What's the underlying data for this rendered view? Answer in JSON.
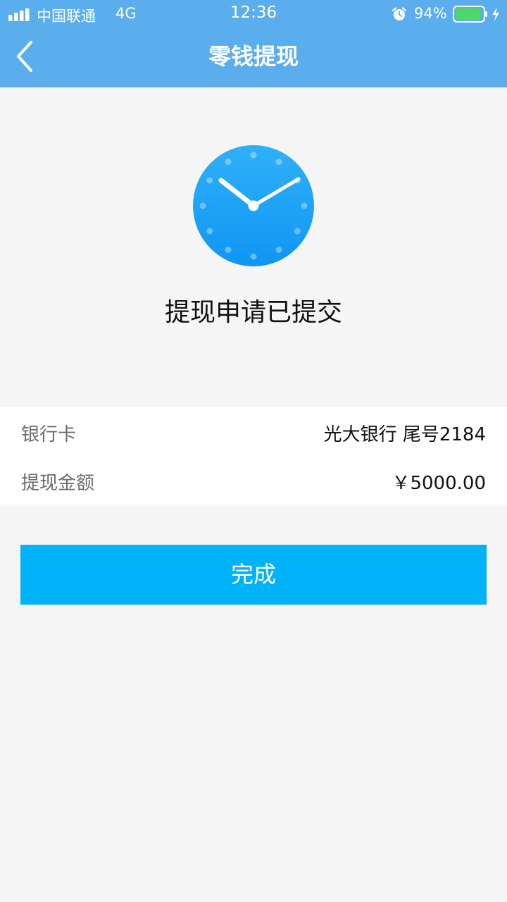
{
  "status_bar": {
    "carrier": "中国联通",
    "network": "4G",
    "time": "12:36",
    "battery_percent": "94%"
  },
  "nav": {
    "title": "零钱提现",
    "back_icon": "chevron-left-icon"
  },
  "result": {
    "icon": "clock-icon",
    "title": "提现申请已提交"
  },
  "details": [
    {
      "label": "银行卡",
      "value": "光大银行 尾号2184"
    },
    {
      "label": "提现金额",
      "value": "￥5000.00"
    }
  ],
  "actions": {
    "done_label": "完成"
  },
  "colors": {
    "header": "#5aaeee",
    "button": "#00b2f7",
    "clock": "#1a9ff5",
    "page_background": "#f5f5f5",
    "battery": "#4cd964"
  }
}
